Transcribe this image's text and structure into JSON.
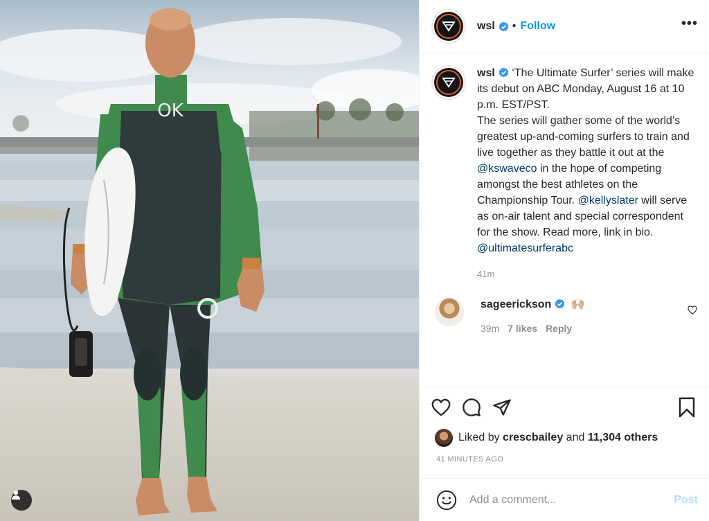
{
  "header": {
    "username": "wsl",
    "separator": "•",
    "follow_label": "Follow",
    "more_label": "•••"
  },
  "photo": {
    "wetsuit_chest_logo": "OK",
    "user_tags_icon": "person-icon"
  },
  "caption": {
    "username": "wsl",
    "line1": "‘The Ultimate Surfer’ series will make its debut on ABC Monday, August 16 at 10 p.m. EST/PST.",
    "line2_a": "The series will gather some of the world’s greatest up-and-coming surfers to train and live together as they battle it out at the ",
    "mention1": "@kswaveco",
    "line2_b": " in the hope of competing amongst the best athletes on the Championship Tour. ",
    "mention2": "@kellyslater",
    "line2_c": " will serve as on-air talent and special correspondent for the show. Read more, link in bio.",
    "mention3": "@ultimatesurferabc",
    "time": "41m"
  },
  "comment": {
    "username": "sageerickson",
    "text": "🙌🏼",
    "time": "39m",
    "likes": "7 likes",
    "reply_label": "Reply"
  },
  "actions": {
    "liked_prefix": "Liked by ",
    "liked_user": "crescbailey",
    "liked_mid": " and ",
    "liked_count": "11,304 others",
    "timestamp": "41 MINUTES AGO"
  },
  "add_comment": {
    "placeholder": "Add a comment...",
    "post_label": "Post"
  },
  "colors": {
    "accent_blue": "#0095f6",
    "post_disabled": "#b2dffc",
    "wetsuit_green": "#3f8a4c",
    "wetsuit_dark": "#2f3a3a"
  }
}
